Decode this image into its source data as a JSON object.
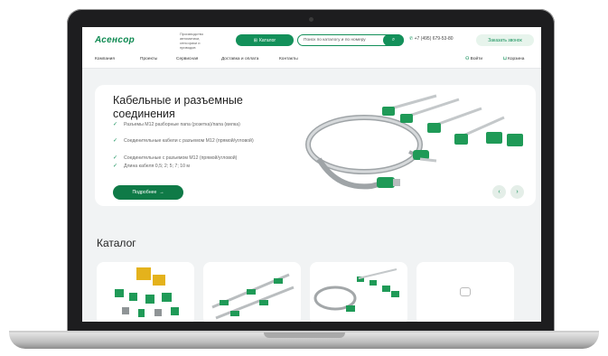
{
  "header": {
    "logo": "Асенсор",
    "tagline": "Производство автоматики, сенсорики и приводов",
    "catalog_button": "Каталог",
    "search_placeholder": "Поиск по каталогу и по номеру",
    "phone": "+7 (495) 679-53-80",
    "callback_button": "Заказать звонок"
  },
  "nav": {
    "items": [
      "Компания",
      "Проекты",
      "Сервисная",
      "Доставка и оплата",
      "Контакты"
    ],
    "login": "Войти",
    "cart": "Корзина"
  },
  "hero": {
    "title": "Кабельные и разъемные соединения",
    "features": [
      "Разъемы M12 разборные папа (розетка)/папа (вилка)",
      "Соединительные кабели с разъемом M12 (прямой/угловой)",
      "Соединительные с разъемом M12 (прямой/угловой)",
      "Длина кабеля 0,5; 2; 5; 7; 10 м"
    ],
    "more_button": "Подробнее"
  },
  "catalog": {
    "title": "Каталог"
  },
  "icons": {
    "catalog": "grid-icon",
    "search": "search-icon",
    "phone": "phone-icon",
    "login": "user-icon",
    "cart": "cart-icon",
    "feature": "check-icon",
    "prev": "chevron-left-icon",
    "next": "chevron-right-icon"
  },
  "colors": {
    "brand": "#13905a",
    "brand_dark": "#0f7a47",
    "page_bg": "#f1f3f4"
  }
}
